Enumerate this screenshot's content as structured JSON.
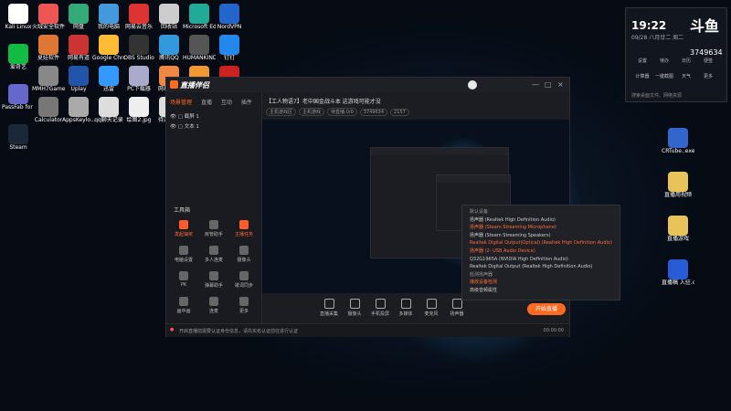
{
  "desktop": {
    "icons": [
      {
        "label": "Kali Linux",
        "color": "#fff"
      },
      {
        "label": "火绒安全软件",
        "color": "#e55"
      },
      {
        "label": "网盘",
        "color": "#3a7"
      },
      {
        "label": "我的电脑",
        "color": "#49d"
      },
      {
        "label": "网易云音乐",
        "color": "#d33"
      },
      {
        "label": "回收站",
        "color": "#ccc"
      },
      {
        "label": "Microsoft Edge",
        "color": "#2a9"
      },
      {
        "label": "NordVPN",
        "color": "#26c"
      },
      {
        "label": "爱奇艺",
        "color": "#1b4"
      },
      {
        "label": "夏娃软件",
        "color": "#d73"
      },
      {
        "label": "网易有道",
        "color": "#c33"
      },
      {
        "label": "Google Chrome",
        "color": "#fb3"
      },
      {
        "label": "OBS Studio",
        "color": "#333"
      },
      {
        "label": "腾讯QQ",
        "color": "#39d"
      },
      {
        "label": "HUMANKIND",
        "color": "#555"
      },
      {
        "label": "钉钉",
        "color": "#28e"
      },
      {
        "label": "PassFab for RAR",
        "color": "#66c"
      },
      {
        "label": "MMH7Game-Win",
        "color": "#888"
      },
      {
        "label": "Uplay",
        "color": "#25a"
      },
      {
        "label": "迅雷",
        "color": "#39f"
      },
      {
        "label": "PC下载器",
        "color": "#aac"
      },
      {
        "label": "网易魔盒",
        "color": "#e84"
      },
      {
        "label": "360安全卫士",
        "color": "#e93"
      },
      {
        "label": "FinalSpeed",
        "color": "#c22"
      },
      {
        "label": "Steam",
        "color": "#1b2838"
      },
      {
        "label": "Calculator",
        "color": "#777"
      },
      {
        "label": "AppsKeylo...",
        "color": "#aaa"
      },
      {
        "label": "qq聊天记录",
        "color": "#ddd"
      },
      {
        "label": "绘图2.jpg",
        "color": "#eee"
      },
      {
        "label": "待办事项",
        "color": "#ddd"
      },
      {
        "label": "游戏",
        "color": "#e8c35a"
      },
      {
        "label": "短视频",
        "color": "#e8c35a"
      }
    ],
    "right_icons": [
      {
        "label": "CRTube..exe",
        "color": "#36c"
      },
      {
        "label": "直播用视频",
        "color": "#e8c35a"
      },
      {
        "label": "直播游戏",
        "color": "#e8c35a"
      },
      {
        "label": "直播稿 入驻.doc",
        "color": "#2a5bd7"
      }
    ]
  },
  "widget": {
    "time": "19:22",
    "date": "09/28 八月廿二 周二",
    "brand": "斗鱼",
    "room_no": "3749634",
    "grid": [
      "设置",
      "待办",
      "日历",
      "便签",
      "计算器",
      "一键截图",
      "天气",
      "更多"
    ],
    "search_hint": "搜索桌面文件、网络资源"
  },
  "app": {
    "name": "直播伴侣",
    "window_controls": [
      "—",
      "□",
      "×"
    ],
    "tabs": [
      "场景管理",
      "直播",
      "互动",
      "插件"
    ],
    "scenes": [
      "截屏 1",
      "文本 1"
    ],
    "tools_title": "工具箱",
    "tools": [
      "发起抽奖",
      "房管助手",
      "主播任务",
      "电脑设置",
      "多人连麦",
      "摄像头",
      "PK",
      "弹幕助手",
      "歌词同步",
      "画中画",
      "连麦",
      "更多"
    ],
    "room_title": "【工人物语7】老中国金战斗本 这游戏可能才没",
    "room_tags": [
      "主机游戏区",
      "主机游戏",
      "待直播:0/0",
      "3749634",
      "2157"
    ],
    "controls": [
      "直播采集",
      "摄像头",
      "手机投屏",
      "多媒体",
      "麦克风",
      "扬声器"
    ],
    "start_btn": "开始直播",
    "status_msg": "开启直播前需要认证身份信息，请先实名认证前往进行认证",
    "status_right": "00:00:00"
  },
  "audio_menu": {
    "items": [
      {
        "text": "默认设备",
        "hl": false,
        "sec": true
      },
      {
        "text": "扬声器 (Realtek High Definition Audio)",
        "hl": false,
        "sec": false
      },
      {
        "text": "扬声器 (Steam Streaming Microphone)",
        "hl": true,
        "sec": false
      },
      {
        "text": "扬声器 (Steam Streaming Speakers)",
        "hl": false,
        "sec": false
      },
      {
        "text": "Realtek Digital Output(Optical) (Realtek High Definition Audio)",
        "hl": true,
        "sec": false
      },
      {
        "text": "扬声器 (2- USB Audio Device)",
        "hl": true,
        "sec": false
      },
      {
        "text": "Q32G1965A (NVIDIA High Definition Audio)",
        "hl": false,
        "sec": false
      },
      {
        "text": "Realtek Digital Output (Realtek High Definition Audio)",
        "hl": false,
        "sec": false
      },
      {
        "text": "检测扬声器",
        "hl": false,
        "sec": true
      },
      {
        "text": "播放设备检测",
        "hl": true,
        "sec": false
      },
      {
        "text": "高级音频属性",
        "hl": false,
        "sec": false
      }
    ]
  }
}
